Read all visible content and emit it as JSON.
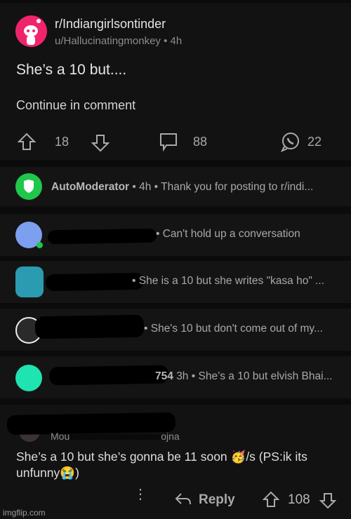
{
  "post": {
    "subreddit": "r/Indiangirlsontinder",
    "author": "u/Hallucinatingmonkey",
    "age": "4h",
    "title": "She’s a 10 but....",
    "body": "Continue in comment",
    "upvotes": "18",
    "comments": "88",
    "shares": "22",
    "accent": "#f0246b"
  },
  "comments": [
    {
      "user": "AutoModerator",
      "age": "4h",
      "preview": "Thank you for posting to r/indi...",
      "avatar_color": "#1fc74a"
    },
    {
      "preview": "• Can't hold up a conversation",
      "avatar_color": "#7d9ff0"
    },
    {
      "preview": "• She is a 10 but she writes \"kasa ho\" ...",
      "avatar_color": "#2a9bb0"
    },
    {
      "preview": "• She's 10 but don't come out of my...",
      "avatar_color": "#2a2a2a"
    },
    {
      "user_fragment": "754",
      "age": "3h",
      "preview": "• She’s a 10 but elvish Bhai...",
      "avatar_color": "#1fe3b0"
    }
  ],
  "expanded_comment": {
    "flair_fragment": "Mou",
    "flair_fragment_end": "ojna",
    "text": "She’s a 10 but she’s gonna be 11 soon 🥳/s (PS:ik its unfunny😭)",
    "reply_label": "Reply",
    "score": "108"
  },
  "watermark": "imgflip.com"
}
